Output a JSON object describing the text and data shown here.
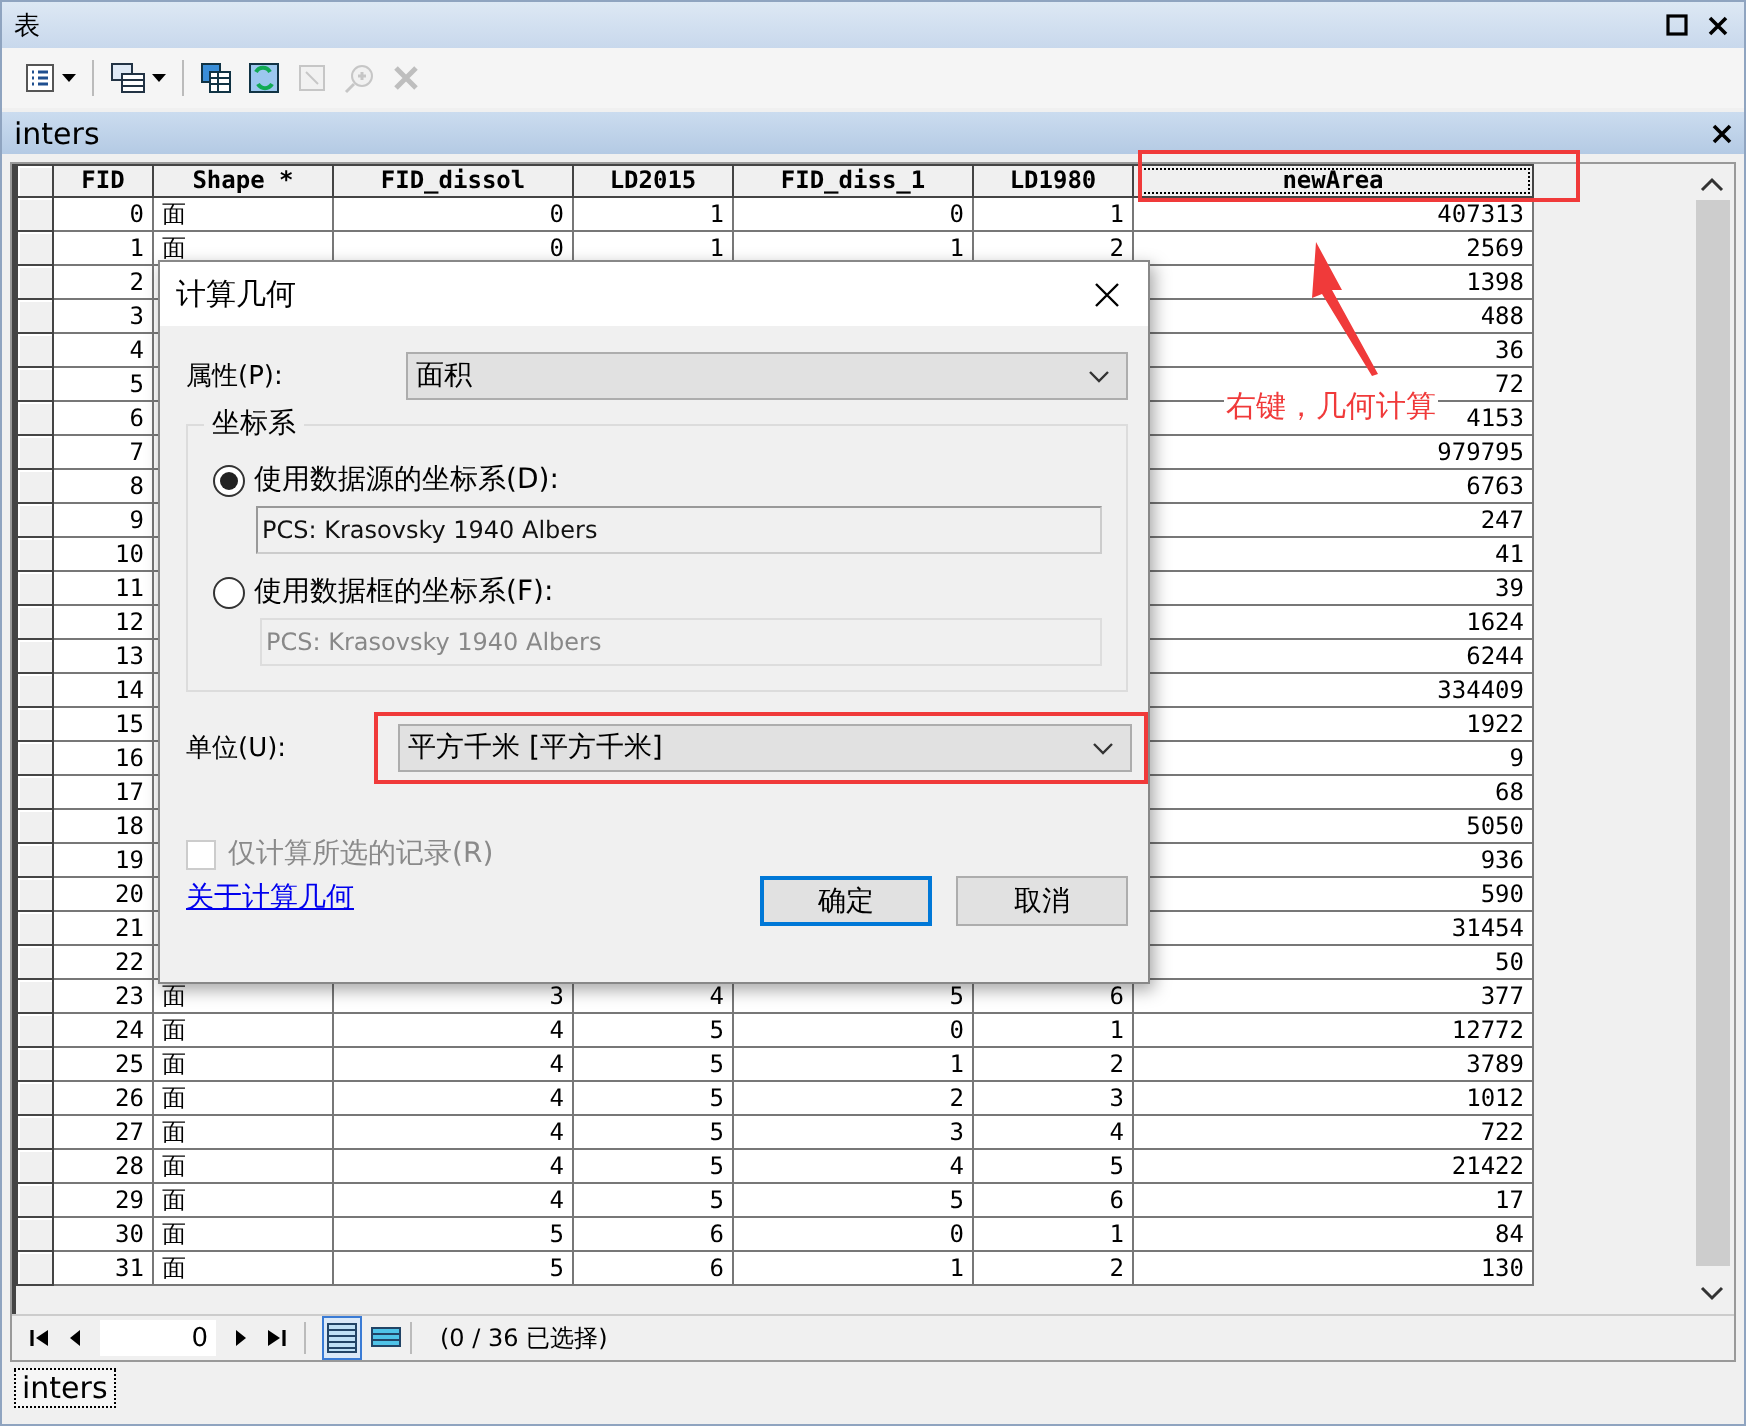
{
  "window": {
    "title": "表"
  },
  "toolbar": [
    {
      "kind": "table-options",
      "menu": true,
      "disabled": false
    },
    {
      "kind": "related-tables",
      "menu": true,
      "disabled": false
    },
    {
      "kind": "select-by-attributes",
      "menu": false,
      "disabled": false
    },
    {
      "kind": "switch-selection",
      "menu": false,
      "disabled": false
    },
    {
      "kind": "clear-selection",
      "menu": false,
      "disabled": true
    },
    {
      "kind": "zoom-selected",
      "menu": false,
      "disabled": true
    },
    {
      "kind": "delete",
      "menu": false,
      "disabled": true
    }
  ],
  "table_tab": {
    "title": "inters"
  },
  "table": {
    "columns": [
      "FID",
      "Shape *",
      "FID_dissol",
      "LD2015",
      "FID_diss_1",
      "LD1980",
      "newArea"
    ],
    "rows": [
      {
        "fid": "0",
        "cells": [
          "面",
          "0",
          "1",
          "0",
          "1"
        ],
        "new_area": "407313"
      },
      {
        "fid": "1",
        "cells": [
          "面",
          "0",
          "1",
          "1",
          "2"
        ],
        "new_area": "2569"
      },
      {
        "fid": "2",
        "new_area": "1398"
      },
      {
        "fid": "3",
        "new_area": "488"
      },
      {
        "fid": "4",
        "new_area": "36"
      },
      {
        "fid": "5",
        "new_area": "72"
      },
      {
        "fid": "6",
        "new_area": "4153"
      },
      {
        "fid": "7",
        "new_area": "979795"
      },
      {
        "fid": "8",
        "new_area": "6763"
      },
      {
        "fid": "9",
        "new_area": "247"
      },
      {
        "fid": "10",
        "new_area": "41"
      },
      {
        "fid": "11",
        "new_area": "39"
      },
      {
        "fid": "12",
        "new_area": "1624"
      },
      {
        "fid": "13",
        "new_area": "6244"
      },
      {
        "fid": "14",
        "new_area": "334409"
      },
      {
        "fid": "15",
        "new_area": "1922"
      },
      {
        "fid": "16",
        "new_area": "9"
      },
      {
        "fid": "17",
        "new_area": "68"
      },
      {
        "fid": "18",
        "new_area": "5050"
      },
      {
        "fid": "19",
        "new_area": "936"
      },
      {
        "fid": "20",
        "new_area": "590"
      },
      {
        "fid": "21",
        "new_area": "31454"
      },
      {
        "fid": "22",
        "new_area": "50"
      },
      {
        "fid": "23",
        "cells": [
          "面",
          "3",
          "4",
          "5",
          "6"
        ],
        "new_area": "377"
      },
      {
        "fid": "24",
        "cells": [
          "面",
          "4",
          "5",
          "0",
          "1"
        ],
        "new_area": "12772"
      },
      {
        "fid": "25",
        "cells": [
          "面",
          "4",
          "5",
          "1",
          "2"
        ],
        "new_area": "3789"
      },
      {
        "fid": "26",
        "cells": [
          "面",
          "4",
          "5",
          "2",
          "3"
        ],
        "new_area": "1012"
      },
      {
        "fid": "27",
        "cells": [
          "面",
          "4",
          "5",
          "3",
          "4"
        ],
        "new_area": "722"
      },
      {
        "fid": "28",
        "cells": [
          "面",
          "4",
          "5",
          "4",
          "5"
        ],
        "new_area": "21422"
      },
      {
        "fid": "29",
        "cells": [
          "面",
          "4",
          "5",
          "5",
          "6"
        ],
        "new_area": "17"
      },
      {
        "fid": "30",
        "cells": [
          "面",
          "5",
          "6",
          "0",
          "1"
        ],
        "new_area": "84"
      },
      {
        "fid": "31",
        "cells": [
          "面",
          "5",
          "6",
          "1",
          "2"
        ],
        "new_area": "130"
      }
    ]
  },
  "navigator": {
    "record": "0",
    "views": [
      {
        "kind": "all",
        "selected": true
      },
      {
        "kind": "selected",
        "selected": false
      }
    ],
    "status": "(0 / 36 已选择)"
  },
  "bottom_tabs": [
    {
      "label": "inters"
    }
  ],
  "dialog": {
    "title": "计算几何",
    "property": {
      "label": "属性(P):",
      "value": "面积"
    },
    "coordinate_group": {
      "title": "坐标系",
      "options": [
        {
          "label": "使用数据源的坐标系(D):",
          "selected": true,
          "value": "PCS: Krasovsky 1940 Albers",
          "disabled": false
        },
        {
          "label": "使用数据框的坐标系(F):",
          "selected": false,
          "value": "PCS: Krasovsky 1940 Albers",
          "disabled": true
        }
      ]
    },
    "unit": {
      "label": "单位(U):",
      "value": "平方千米 [平方千米]"
    },
    "selected_only": {
      "label": "仅计算所选的记录(R)",
      "checked": false,
      "disabled": true
    },
    "help_link": "关于计算几何",
    "buttons": [
      {
        "label": "确定",
        "default": true
      },
      {
        "label": "取消",
        "default": false
      }
    ]
  },
  "annotation": {
    "text": "右键，几何计算"
  }
}
